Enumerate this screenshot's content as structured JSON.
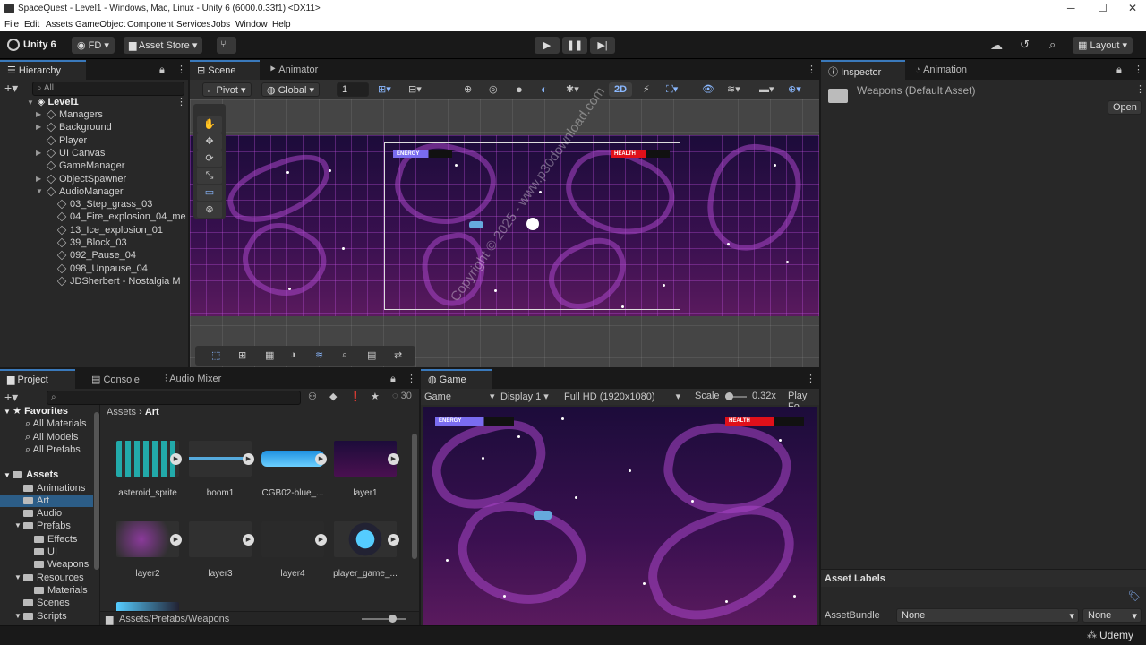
{
  "window": {
    "title": "SpaceQuest - Level1 - Windows, Mac, Linux - Unity 6 (6000.0.33f1) <DX11>"
  },
  "menu": [
    "File",
    "Edit",
    "Assets",
    "GameObject",
    "Component",
    "Services",
    "Jobs",
    "Window",
    "Help"
  ],
  "toolbar": {
    "brand": "Unity 6",
    "account": "FD",
    "asset_store": "Asset Store",
    "layout": "Layout"
  },
  "hierarchy": {
    "tab": "Hierarchy",
    "search_placeholder": "All",
    "scene": "Level1",
    "items": [
      "Managers",
      "Background",
      "Player",
      "UI Canvas",
      "GameManager",
      "ObjectSpawner",
      "AudioManager"
    ],
    "audio_children": [
      "03_Step_grass_03",
      "04_Fire_explosion_04_me",
      "13_Ice_explosion_01",
      "39_Block_03",
      "092_Pause_04",
      "098_Unpause_04",
      "JDSherbert - Nostalgia M"
    ]
  },
  "scene": {
    "tabs": [
      "Scene",
      "Animator"
    ],
    "pivot": "Pivot",
    "global": "Global",
    "snap": "1",
    "mode2d": "2D",
    "energy": "ENERGY",
    "health": "HEALTH"
  },
  "watermark": "Copyright © 2025 - www.p30download.com",
  "inspector": {
    "tabs": [
      "Inspector",
      "Animation"
    ],
    "title": "Weapons (Default Asset)",
    "open": "Open",
    "asset_labels": "Asset Labels",
    "asset_bundle": "AssetBundle",
    "bundle_value": "None",
    "variant_value": "None"
  },
  "project": {
    "tabs": [
      "Project",
      "Console",
      "Audio Mixer"
    ],
    "count": "30",
    "favorites": "Favorites",
    "fav_items": [
      "All Materials",
      "All Models",
      "All Prefabs"
    ],
    "assets": "Assets",
    "tree": [
      "Animations",
      "Art",
      "Audio",
      "Prefabs",
      "Effects",
      "UI",
      "Weapons",
      "Resources",
      "Materials",
      "Scenes",
      "Scripts"
    ],
    "breadcrumb": [
      "Assets",
      "Art"
    ],
    "grid": [
      "asteroid_sprite",
      "boom1",
      "CGB02-blue_...",
      "layer1",
      "layer2",
      "layer3",
      "layer4",
      "player_game_..."
    ],
    "path": "Assets/Prefabs/Weapons"
  },
  "game": {
    "tab": "Game",
    "mode": "Game",
    "display": "Display 1",
    "resolution": "Full HD (1920x1080)",
    "scale_label": "Scale",
    "scale_value": "0.32x",
    "play_focus": "Play Fo",
    "energy": "ENERGY",
    "health": "HEALTH"
  },
  "udemy": "Udemy",
  "colors": {
    "accent": "#3a79bb",
    "energy": "#7a6cf0",
    "health": "#e0101a"
  }
}
